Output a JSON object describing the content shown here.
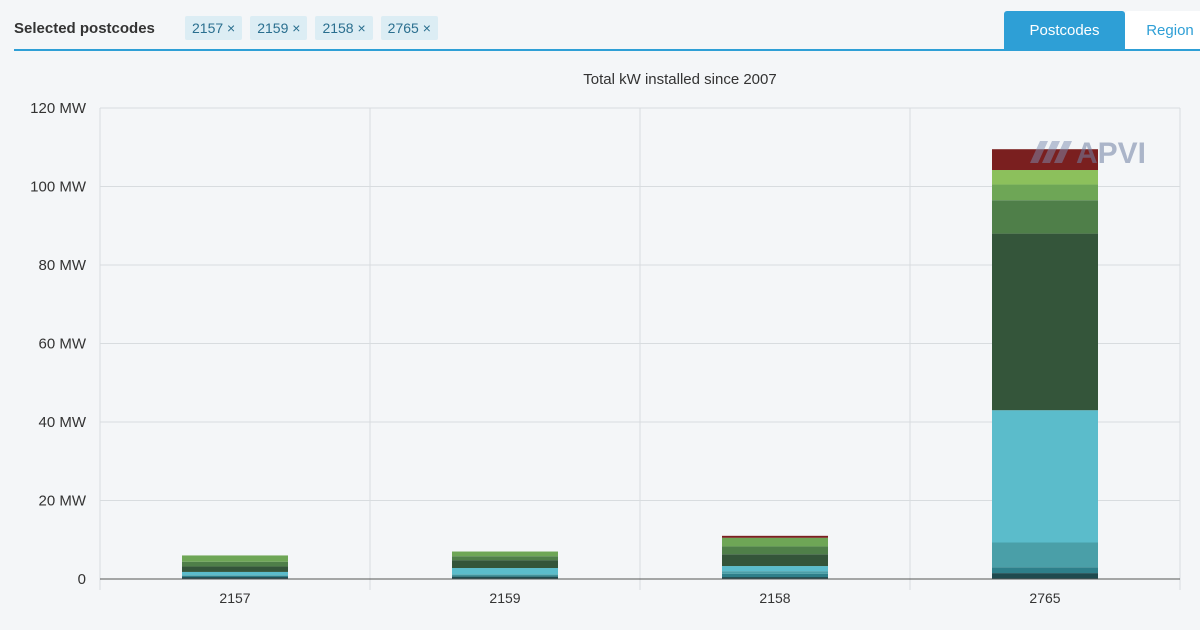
{
  "header": {
    "selected_label": "Selected postcodes",
    "chips": [
      "2157 ×",
      "2159 ×",
      "2158 ×",
      "2765 ×"
    ],
    "tabs": {
      "postcodes": "Postcodes",
      "region": "Region"
    },
    "accent_color": "#2e9fd6"
  },
  "logo": {
    "text": "APVI"
  },
  "chart_data": {
    "type": "bar",
    "stacked": true,
    "title": "Total kW installed since 2007",
    "categories": [
      "2157",
      "2159",
      "2158",
      "2765"
    ],
    "ylim": [
      0,
      120
    ],
    "yticks": [
      0,
      20,
      40,
      60,
      80,
      100,
      120
    ],
    "ytick_labels": [
      "0",
      "20 MW",
      "40 MW",
      "60 MW",
      "80 MW",
      "100 MW",
      "120 MW"
    ],
    "grid": true,
    "series": [
      {
        "color": "#1f4a4f",
        "values": [
          0.5,
          0.6,
          0.5,
          1.5
        ]
      },
      {
        "color": "#2e7f8a",
        "values": [
          0.3,
          0.3,
          0.8,
          1.5
        ]
      },
      {
        "color": "#4a9fa8",
        "values": [
          0.2,
          0.3,
          0.7,
          6.3
        ]
      },
      {
        "color": "#5bbccb",
        "values": [
          0.8,
          1.6,
          1.3,
          33.7
        ]
      },
      {
        "color": "#34553a",
        "values": [
          1.4,
          2.0,
          3.0,
          45.0
        ]
      },
      {
        "color": "#4f7f49",
        "values": [
          1.2,
          1.0,
          2.0,
          8.5
        ]
      },
      {
        "color": "#6ea656",
        "values": [
          1.6,
          1.2,
          2.2,
          4.0
        ]
      },
      {
        "color": "#8cc05c",
        "values": [
          0.0,
          0.0,
          0.0,
          3.7
        ]
      },
      {
        "color": "#7a1f1f",
        "values": [
          0.0,
          0.0,
          0.5,
          5.3
        ]
      }
    ]
  }
}
